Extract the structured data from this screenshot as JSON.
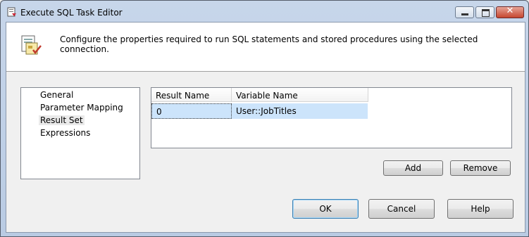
{
  "window": {
    "title": "Execute SQL Task Editor",
    "close_glyph": "✕"
  },
  "header": {
    "description": "Configure the properties required to run SQL statements and stored procedures using the selected connection."
  },
  "nav": {
    "items": [
      {
        "label": "General"
      },
      {
        "label": "Parameter Mapping"
      },
      {
        "label": "Result Set",
        "selected": true
      },
      {
        "label": "Expressions"
      }
    ]
  },
  "result_set": {
    "columns": [
      "Result Name",
      "Variable Name"
    ],
    "rows": [
      {
        "result_name": "0",
        "variable_name": "User::JobTitles"
      }
    ]
  },
  "buttons": {
    "add": "Add",
    "remove": "Remove",
    "ok": "OK",
    "cancel": "Cancel",
    "help": "Help"
  },
  "colors": {
    "selection": "#cce4fb",
    "title_bar": "#c7d6ea"
  }
}
